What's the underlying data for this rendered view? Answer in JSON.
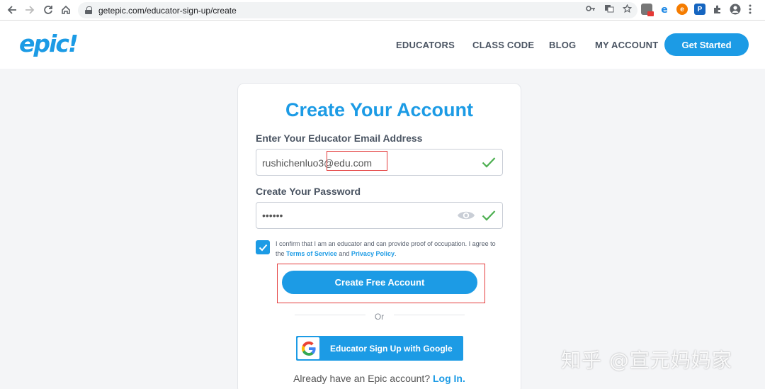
{
  "browser": {
    "url": "getepic.com/educator-sign-up/create",
    "nav_icons": [
      "back-icon",
      "forward-icon",
      "reload-icon",
      "home-icon"
    ],
    "omnibox_icons": [
      "key-icon",
      "translate-icon",
      "star-icon"
    ],
    "extension_icons": [
      "extension-red-icon",
      "ie-icon",
      "extension-orange-icon",
      "extension-p-icon",
      "puzzle-icon",
      "profile-icon",
      "menu-icon"
    ]
  },
  "site": {
    "logo": "epic!",
    "nav": {
      "educators": "EDUCATORS",
      "class_code": "CLASS CODE",
      "blog": "BLOG",
      "my_account": "MY ACCOUNT"
    },
    "cta": "Get Started"
  },
  "form": {
    "title": "Create Your Account",
    "email_label": "Enter Your Educator Email Address",
    "email_value": "rushichenluo3@edu.com",
    "password_label": "Create Your Password",
    "password_value": "••••••",
    "consent_text_1": "I confirm that I am an educator and can provide proof of occupation. I agree to the ",
    "terms_link": "Terms of Service",
    "consent_and": " and ",
    "privacy_link": "Privacy Policy",
    "consent_end": ".",
    "submit": "Create Free Account",
    "or": "Or",
    "google_button": "Educator Sign Up with Google",
    "login_prompt": "Already have an Epic account?",
    "login_link": "Log In.",
    "accent_color": "#1c9be5",
    "valid_color": "#4caf50",
    "highlight_color": "#e43d3d"
  },
  "watermark": "知乎 @宣元妈妈家"
}
